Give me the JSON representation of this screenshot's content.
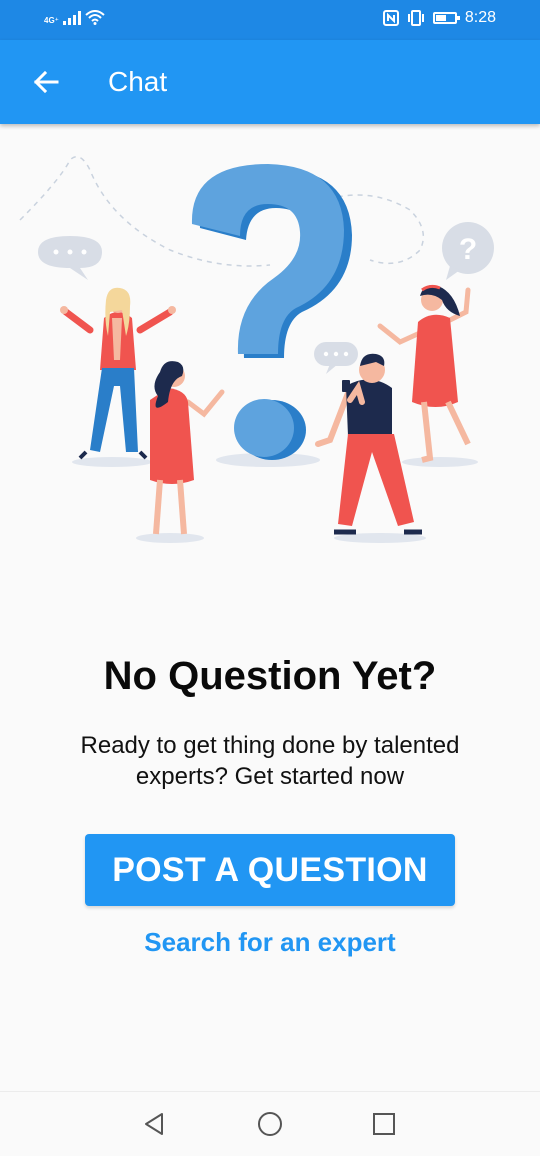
{
  "status_bar": {
    "network_label": "4G⁺",
    "time": "8:28",
    "battery_level": 0.55,
    "icons": [
      "signal-icon",
      "wifi-icon",
      "nfc-icon",
      "vibrate-icon",
      "battery-icon"
    ]
  },
  "app_bar": {
    "title": "Chat",
    "back_icon": "arrow-left-icon"
  },
  "empty_state": {
    "headline": "No Question Yet?",
    "subtitle": "Ready to get thing done by talented experts? Get started now",
    "primary_button": "POST A QUESTION",
    "secondary_link": "Search for an expert"
  },
  "colors": {
    "primary": "#2196f3",
    "status_bar": "#1e88e5",
    "question_mark": "#5ea3de",
    "question_mark_shadow": "#2a7ec9",
    "accent_red": "#f0544f",
    "navy": "#1d2a4d"
  },
  "nav_bar": {
    "icons": [
      "back-triangle-icon",
      "home-circle-icon",
      "recents-square-icon"
    ]
  }
}
